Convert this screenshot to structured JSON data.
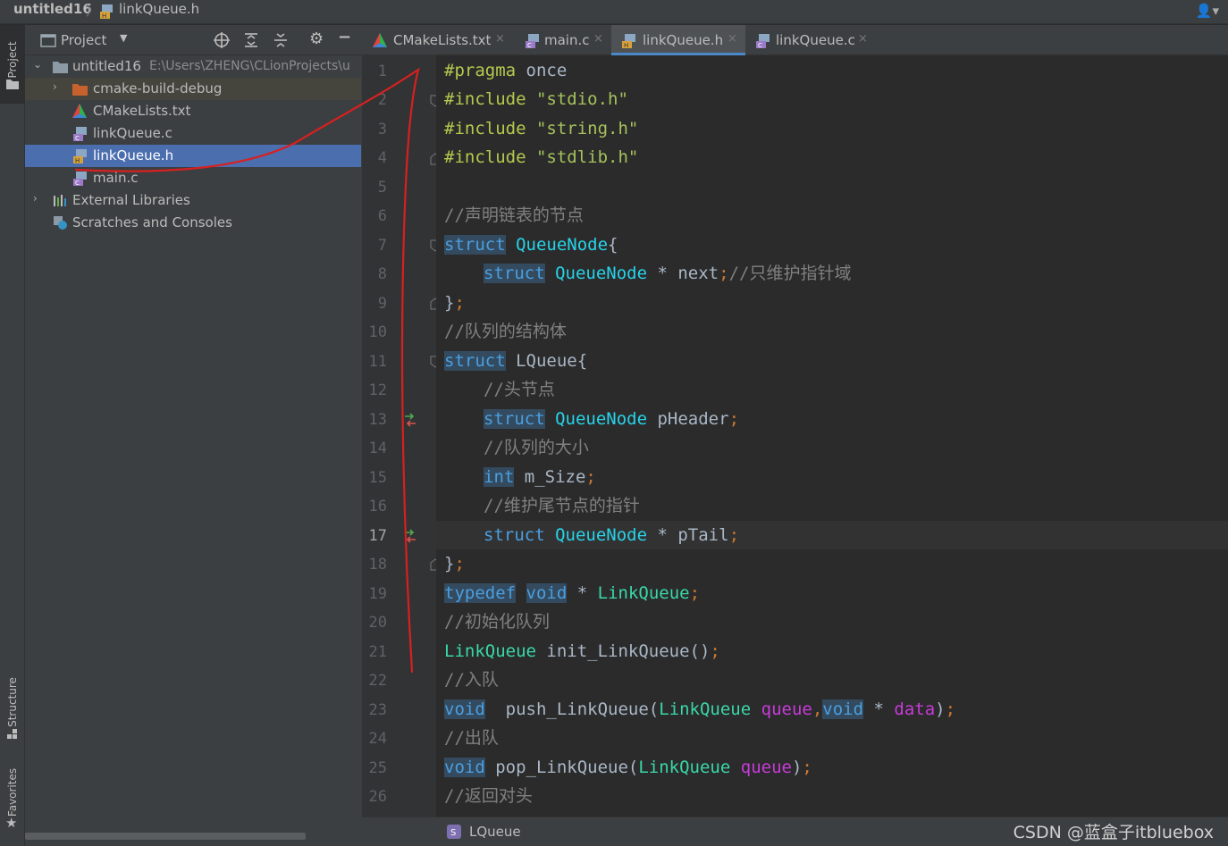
{
  "breadcrumb": {
    "project": "untitled16",
    "sep": "〉",
    "file": "linkQueue.h"
  },
  "toolstripe": {
    "project": "Project",
    "structure": "Structure",
    "favorites": "Favorites"
  },
  "project_panel": {
    "title": "Project",
    "tree": [
      {
        "label": "untitled16",
        "sub": "E:\\Users\\ZHENG\\CLionProjects\\u",
        "icon": "folder-icon",
        "expanded": true
      },
      {
        "label": "cmake-build-debug",
        "icon": "orange-folder-icon",
        "expanded": false
      },
      {
        "label": "CMakeLists.txt",
        "icon": "cmake-icon"
      },
      {
        "label": "linkQueue.c",
        "icon": "c-file-icon"
      },
      {
        "label": "linkQueue.h",
        "icon": "h-file-icon",
        "selected": true
      },
      {
        "label": "main.c",
        "icon": "c-file-icon"
      },
      {
        "label": "External Libraries",
        "icon": "library-icon",
        "expanded": false
      },
      {
        "label": "Scratches and Consoles",
        "icon": "scratches-icon"
      }
    ]
  },
  "editor_tabs": [
    {
      "label": "CMakeLists.txt",
      "icon": "cmake-icon"
    },
    {
      "label": "main.c",
      "icon": "c-file-icon"
    },
    {
      "label": "linkQueue.h",
      "icon": "h-file-icon",
      "active": true
    },
    {
      "label": "linkQueue.c",
      "icon": "c-file-icon"
    }
  ],
  "close_glyph": "×",
  "code": {
    "line_numbers": [
      "1",
      "2",
      "3",
      "4",
      "5",
      "6",
      "7",
      "8",
      "9",
      "10",
      "11",
      "12",
      "13",
      "14",
      "15",
      "16",
      "17",
      "18",
      "19",
      "20",
      "21",
      "22",
      "23",
      "24",
      "25",
      "26"
    ],
    "current_line": "17",
    "l1": [
      "#pragma",
      " once"
    ],
    "l2": [
      "#include",
      " ",
      "\"stdio.h\""
    ],
    "l3": [
      "#include",
      " ",
      "\"string.h\""
    ],
    "l4": [
      "#include",
      " ",
      "\"stdlib.h\""
    ],
    "l6": "//声明链表的节点",
    "l7": [
      "struct",
      " ",
      "QueueNode",
      "{"
    ],
    "l8": [
      "struct",
      " ",
      "QueueNode",
      " * next",
      ";",
      "//只维护指针域"
    ],
    "l9": [
      "}",
      ";"
    ],
    "l10": "//队列的结构体",
    "l11": [
      "struct",
      " LQueue{"
    ],
    "l12": "//头节点",
    "l13": [
      "struct",
      " ",
      "QueueNode",
      " pHeader",
      ";"
    ],
    "l14": "//队列的大小",
    "l15": [
      "int",
      " m_Size",
      ";"
    ],
    "l16": "//维护尾节点的指针",
    "l17": [
      "struct",
      " ",
      "QueueNode",
      " * pTail",
      ";"
    ],
    "l18": [
      "}",
      ";"
    ],
    "l19": [
      "typedef",
      " ",
      "void",
      " * ",
      "LinkQueue",
      ";"
    ],
    "l20": "//初始化队列",
    "l21": [
      "LinkQueue",
      " init_LinkQueue()",
      ";"
    ],
    "l22": "//入队",
    "l23": [
      "void",
      "  push_LinkQueue(",
      "LinkQueue",
      " ",
      "queue",
      ",",
      "void",
      " * ",
      "data",
      ")",
      ";"
    ],
    "l24": "//出队",
    "l25": [
      "void",
      " pop_LinkQueue(",
      "LinkQueue",
      " ",
      "queue",
      ")",
      ";"
    ],
    "l26": "//返回对头"
  },
  "statusbar": {
    "context": "LQueue",
    "watermark": "CSDN @蓝盒子itbluebox"
  },
  "colors": {
    "background": "#2b2b2b",
    "panel": "#3c3f41",
    "selection": "#4b6eaf",
    "keyword": "#4a9fe0",
    "annotation": "#d82020"
  }
}
